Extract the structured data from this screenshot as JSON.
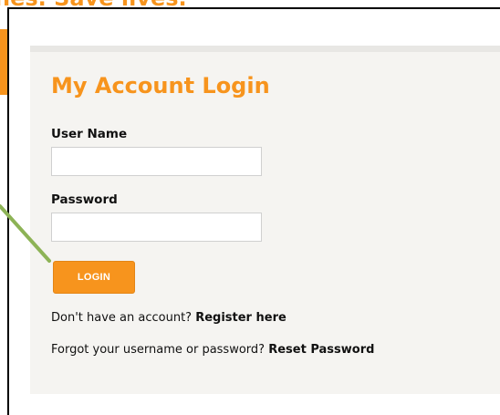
{
  "banner": {
    "text": "nes. Save lives."
  },
  "login": {
    "title": "My Account Login",
    "username_label": "User Name",
    "username_value": "",
    "password_label": "Password",
    "password_value": "",
    "button_label": "LOGIN"
  },
  "footer": {
    "register_prompt": "Don't have an account? ",
    "register_link": "Register here",
    "reset_prompt": "Forgot your username or password? ",
    "reset_link": "Reset Password"
  },
  "colors": {
    "accent": "#f7941d",
    "arrow": "#8db356"
  }
}
